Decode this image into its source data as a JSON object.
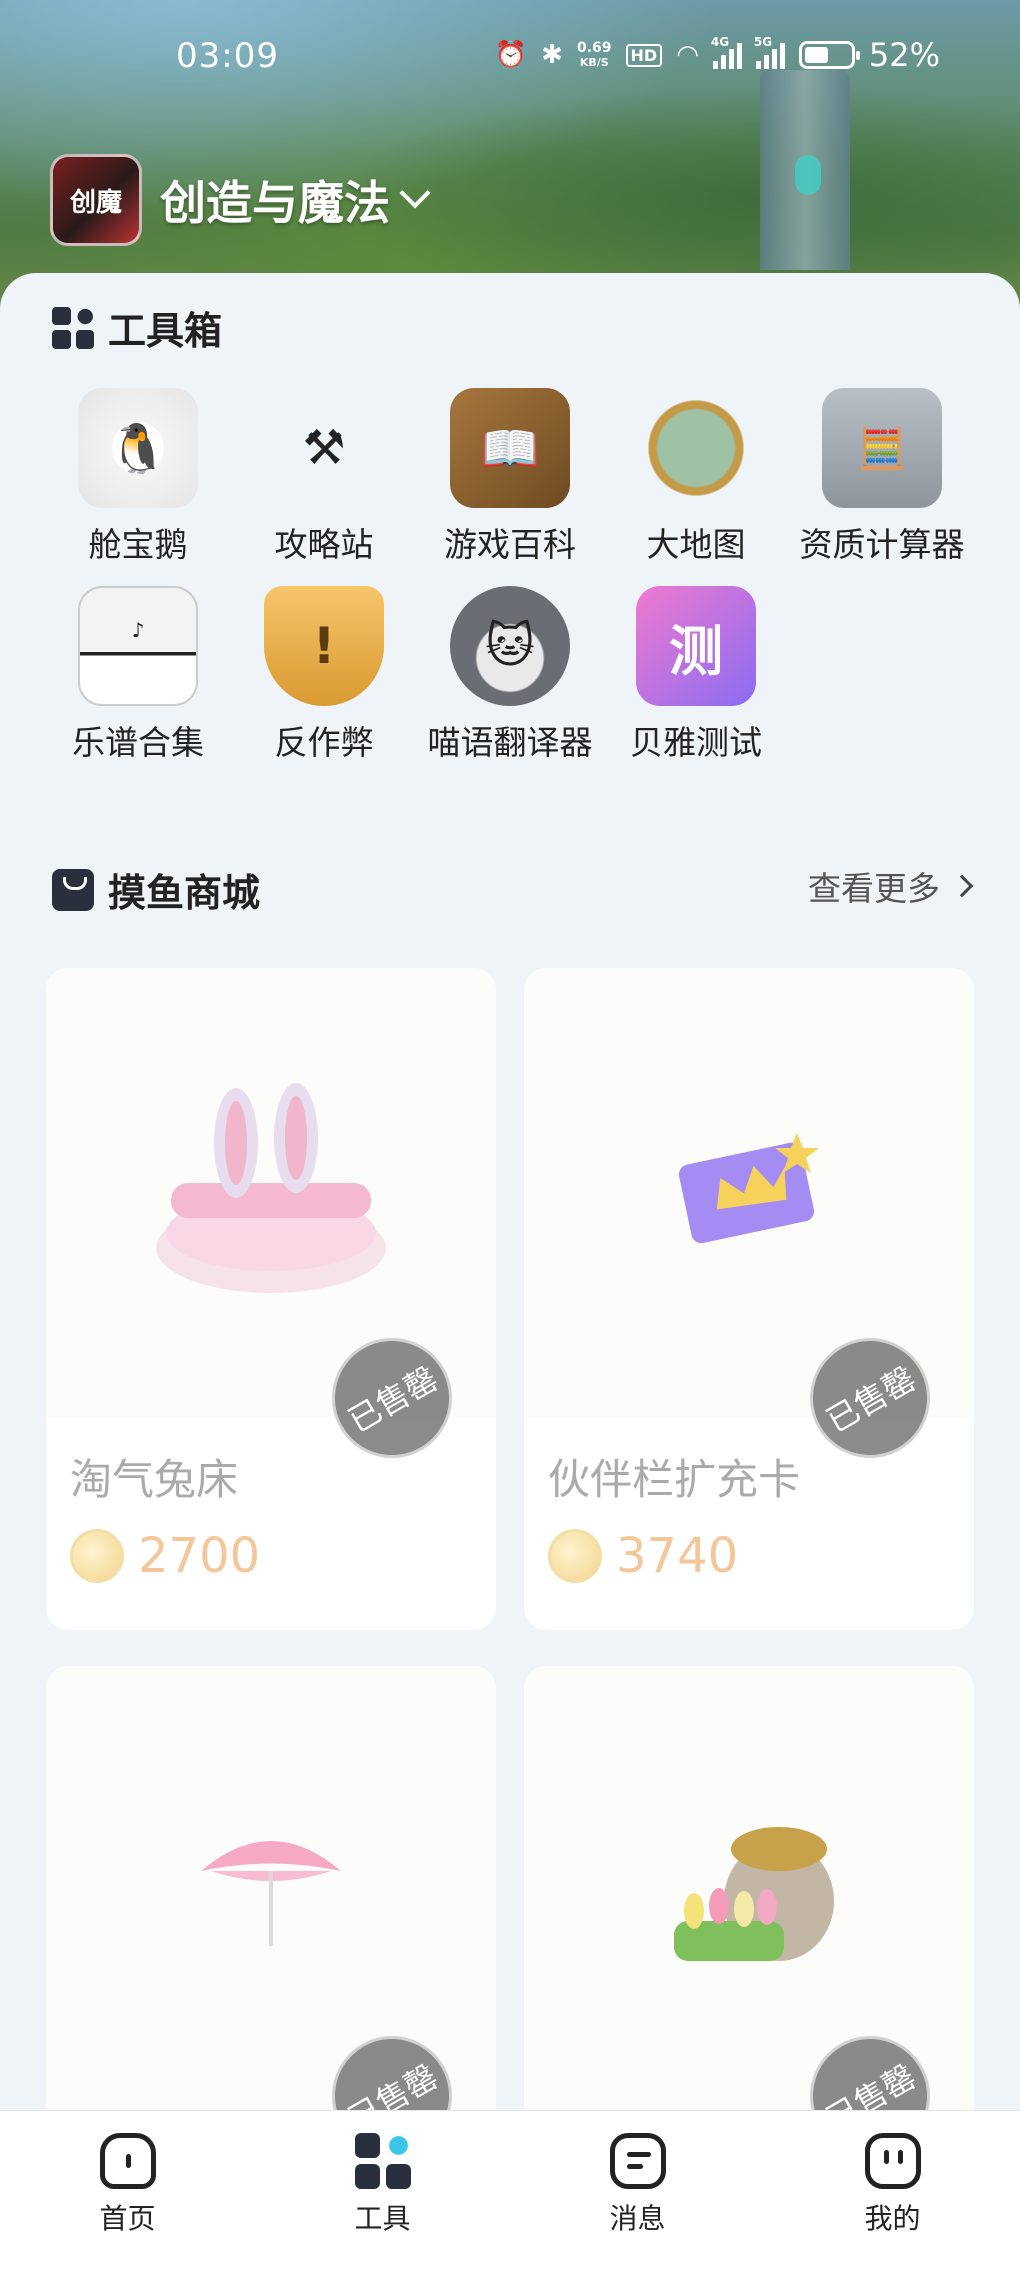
{
  "status_bar": {
    "time": "03:09",
    "net_speed": "0.69",
    "net_unit": "KB/S",
    "hd": "HD",
    "sig1": "4G",
    "sig2": "5G",
    "battery_level": 52,
    "battery_pct": "52%"
  },
  "header": {
    "game_title": "创造与魔法",
    "logo_text": "创魔"
  },
  "toolbox": {
    "title": "工具箱",
    "items": [
      {
        "label": "舱宝鹅",
        "icon": "penguin-icon"
      },
      {
        "label": "攻略站",
        "icon": "axes-icon"
      },
      {
        "label": "游戏百科",
        "icon": "book-icon"
      },
      {
        "label": "大地图",
        "icon": "map-compass-icon"
      },
      {
        "label": "资质计算器",
        "icon": "calculator-icon"
      },
      {
        "label": "乐谱合集",
        "icon": "piano-icon"
      },
      {
        "label": "反作弊",
        "icon": "warning-shield-icon"
      },
      {
        "label": "喵语翻译器",
        "icon": "cat-icon"
      },
      {
        "label": "贝雅测试",
        "icon": "test-icon"
      }
    ]
  },
  "shop": {
    "title": "摸鱼商城",
    "more_label": "查看更多",
    "sold_label": "已售罄",
    "products": [
      {
        "name": "淘气兔床",
        "price": "2700"
      },
      {
        "name": "伙伴栏扩充卡",
        "price": "3740"
      },
      {
        "name": "",
        "price": ""
      },
      {
        "name": "",
        "price": ""
      }
    ]
  },
  "bottom_nav": [
    {
      "label": "首页"
    },
    {
      "label": "工具"
    },
    {
      "label": "消息"
    },
    {
      "label": "我的"
    }
  ],
  "colors": {
    "accent": "#3bc6e8",
    "price": "#f4c79a",
    "dark_icon": "#2a2f3d"
  }
}
